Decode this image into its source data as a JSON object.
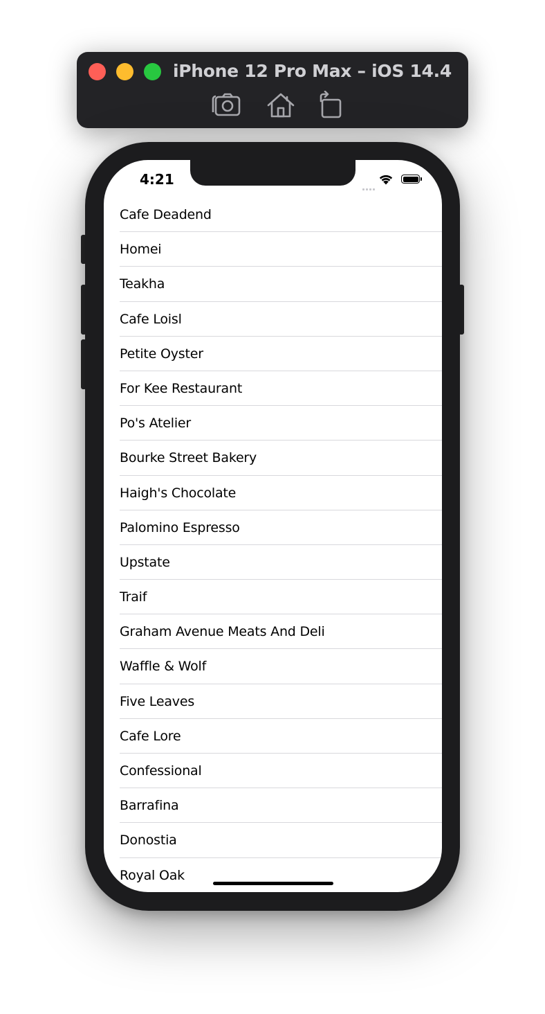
{
  "simulator": {
    "title": "iPhone 12 Pro Max – iOS 14.4",
    "window_controls": [
      "close-button",
      "minimize-button",
      "zoom-button"
    ],
    "toolbar": [
      "screenshot-icon",
      "home-icon",
      "rotate-icon"
    ],
    "colors": {
      "close": "#ff5f57",
      "minimize": "#febc2e",
      "zoom": "#28c840"
    }
  },
  "status_bar": {
    "time": "4:21",
    "icons": [
      "signal-icon",
      "wifi-icon",
      "battery-icon"
    ]
  },
  "list": {
    "items": [
      "Cafe Deadend",
      "Homei",
      "Teakha",
      "Cafe Loisl",
      "Petite Oyster",
      "For Kee Restaurant",
      "Po's Atelier",
      "Bourke Street Bakery",
      "Haigh's Chocolate",
      "Palomino Espresso",
      "Upstate",
      "Traif",
      "Graham Avenue Meats And Deli",
      "Waffle & Wolf",
      "Five Leaves",
      "Cafe Lore",
      "Confessional",
      "Barrafina",
      "Donostia",
      "Royal Oak"
    ]
  }
}
